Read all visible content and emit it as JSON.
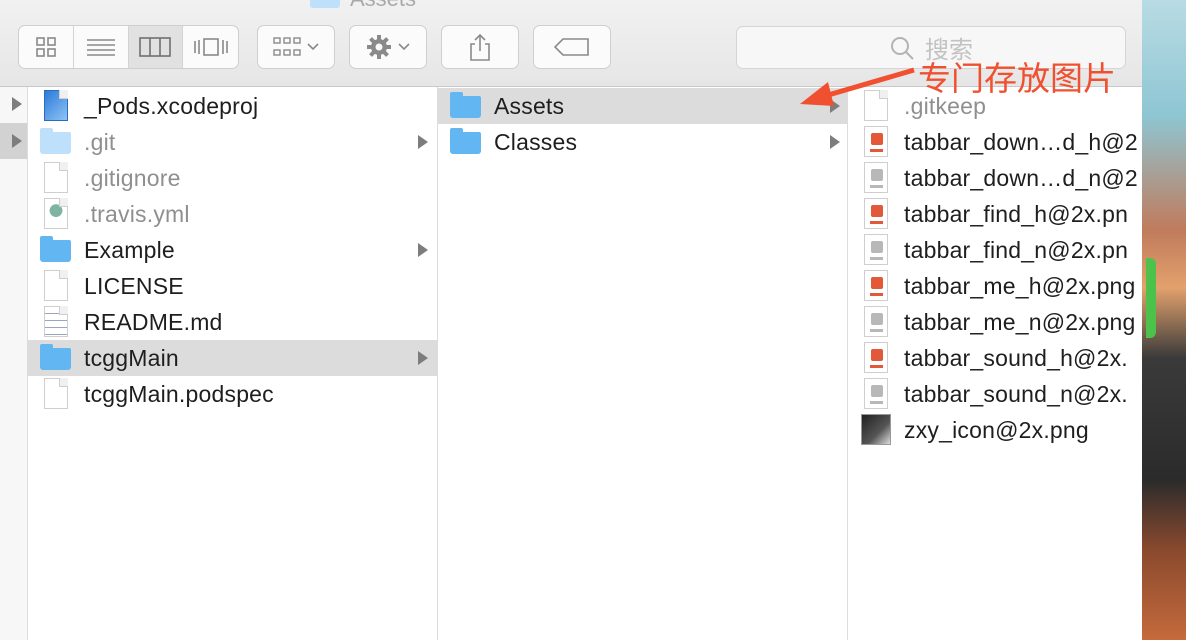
{
  "window": {
    "title": "Assets"
  },
  "search": {
    "placeholder": "搜索"
  },
  "annotation": {
    "text": "专门存放图片",
    "color": "#f0502f"
  },
  "columns": {
    "col1": [
      {
        "name": "_Pods.xcodeproj",
        "icon": "xcodeproj-icon",
        "dim": false,
        "arrow": false,
        "selected": false
      },
      {
        "name": ".git",
        "icon": "folder-icon",
        "dim": true,
        "arrow": true,
        "selected": false
      },
      {
        "name": ".gitignore",
        "icon": "file-icon",
        "dim": true,
        "arrow": false,
        "selected": false
      },
      {
        "name": ".travis.yml",
        "icon": "yml-icon",
        "dim": true,
        "arrow": false,
        "selected": false
      },
      {
        "name": "Example",
        "icon": "folder-icon",
        "dim": false,
        "arrow": true,
        "selected": false
      },
      {
        "name": "LICENSE",
        "icon": "file-icon",
        "dim": false,
        "arrow": false,
        "selected": false
      },
      {
        "name": "README.md",
        "icon": "text-file-icon",
        "dim": false,
        "arrow": false,
        "selected": false
      },
      {
        "name": "tcggMain",
        "icon": "folder-icon",
        "dim": false,
        "arrow": true,
        "selected": true
      },
      {
        "name": "tcggMain.podspec",
        "icon": "file-icon",
        "dim": false,
        "arrow": false,
        "selected": false
      }
    ],
    "col2": [
      {
        "name": "Assets",
        "icon": "folder-icon",
        "dim": false,
        "arrow": true,
        "selected": true
      },
      {
        "name": "Classes",
        "icon": "folder-icon",
        "dim": false,
        "arrow": true,
        "selected": false
      }
    ],
    "col3": [
      {
        "name": ".gitkeep",
        "icon": "file-icon",
        "dim": true,
        "accent": ""
      },
      {
        "name": "tabbar_down…d_h@2",
        "icon": "image-icon",
        "dim": false,
        "accent": "#e4583a"
      },
      {
        "name": "tabbar_down…d_n@2",
        "icon": "image-icon",
        "dim": false,
        "accent": "#b8b8b8"
      },
      {
        "name": "tabbar_find_h@2x.pn",
        "icon": "image-icon",
        "dim": false,
        "accent": "#e4583a"
      },
      {
        "name": "tabbar_find_n@2x.pn",
        "icon": "image-icon",
        "dim": false,
        "accent": "#b8b8b8"
      },
      {
        "name": "tabbar_me_h@2x.png",
        "icon": "image-icon",
        "dim": false,
        "accent": "#e4583a"
      },
      {
        "name": "tabbar_me_n@2x.png",
        "icon": "image-icon",
        "dim": false,
        "accent": "#b8b8b8"
      },
      {
        "name": "tabbar_sound_h@2x.",
        "icon": "image-icon",
        "dim": false,
        "accent": "#e4583a"
      },
      {
        "name": "tabbar_sound_n@2x.",
        "icon": "image-icon",
        "dim": false,
        "accent": "#b8b8b8"
      },
      {
        "name": "zxy_icon@2x.png",
        "icon": "photo-icon",
        "dim": false,
        "accent": "#333333"
      }
    ]
  }
}
